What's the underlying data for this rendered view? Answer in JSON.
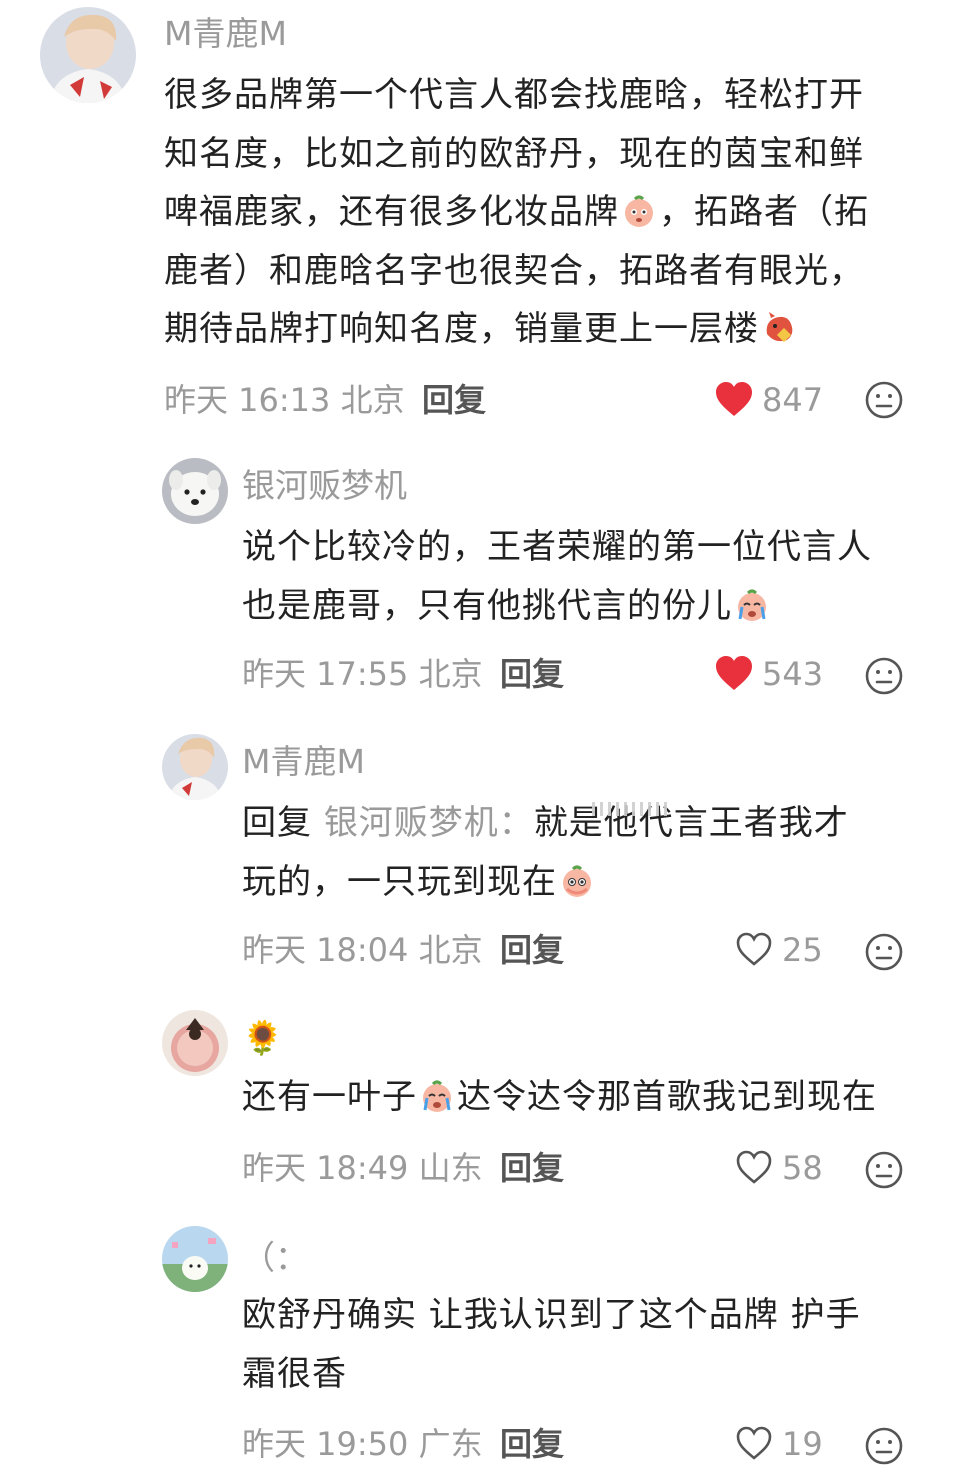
{
  "comments": [
    {
      "username": "M青鹿M",
      "lines": [
        "很多品牌第一个代言人都会找鹿晗，轻松打开",
        "知名度，比如之前的欧舒丹，现在的茵宝和鲜",
        "啤福鹿家，还有很多化妆品牌",
        "，拓路者（拓",
        "鹿者）和鹿晗名字也很契合，拓路者有眼光，",
        "期待品牌打响知名度，销量更上一层楼"
      ],
      "time": "昨天 16:13 北京",
      "reply_label": "回复",
      "likes": "847",
      "liked": true
    },
    {
      "username": "银河贩梦机",
      "lines": [
        "说个比较冷的，王者荣耀的第一位代言人",
        "也是鹿哥，只有他挑代言的份儿"
      ],
      "time": "昨天 17:55 北京",
      "reply_label": "回复",
      "likes": "543",
      "liked": true
    },
    {
      "username": "M青鹿M",
      "reply_prefix": "回复",
      "reply_target": "银河贩梦机：",
      "lines": [
        "就是他代言王者我才",
        "玩的，一只玩到现在"
      ],
      "time": "昨天 18:04 北京",
      "reply_label": "回复",
      "likes": "25",
      "liked": false
    },
    {
      "username": "🌻",
      "lines": [
        "还有一叶子",
        "达令达令那首歌我记到现在"
      ],
      "time": "昨天 18:49 山东",
      "reply_label": "回复",
      "likes": "58",
      "liked": false
    },
    {
      "username": "（：",
      "lines": [
        "欧舒丹确实 让我认识到了这个品牌 护手",
        "霜很香"
      ],
      "time": "昨天 19:50 广东",
      "reply_label": "回复",
      "likes": "19",
      "liked": false
    }
  ],
  "colors": {
    "liked_heart": "#e8313c",
    "meta_gray": "#9a9a9a",
    "text": "#222222"
  },
  "icons": {
    "liked": "heart-filled-icon",
    "unliked": "heart-outline-icon",
    "more": "face-emoji-icon"
  }
}
